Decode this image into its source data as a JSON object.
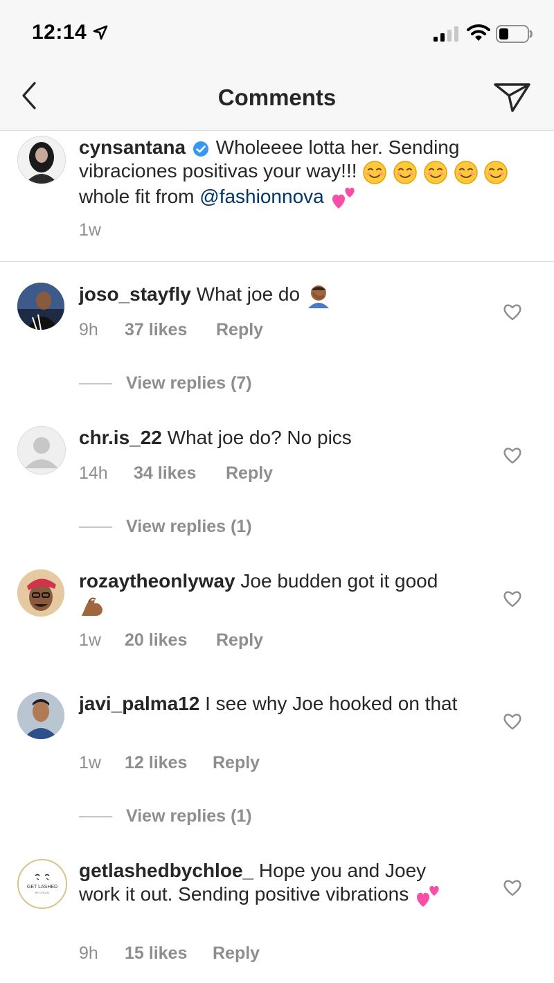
{
  "status": {
    "time": "12:14"
  },
  "nav": {
    "title": "Comments"
  },
  "caption": {
    "username": "cynsantana",
    "text_1": " Wholeeee lotta her. Sending vibraciones positivas your way!!! ",
    "text_2": " whole fit from ",
    "mention": "@fashionnova",
    "time": "1w"
  },
  "comments": [
    {
      "username": "joso_stayfly",
      "text": " What joe do ",
      "time": "9h",
      "likes": "37 likes",
      "reply": "Reply",
      "view_replies": "View replies (7)"
    },
    {
      "username": "chr.is_22",
      "text": " What joe do? No pics",
      "time": "14h",
      "likes": "34 likes",
      "reply": "Reply",
      "view_replies": "View replies (1)"
    },
    {
      "username": "rozaytheonlyway",
      "text": " Joe budden got it good ",
      "time": "1w",
      "likes": "20 likes",
      "reply": "Reply"
    },
    {
      "username": "javi_palma12",
      "text": " I see why Joe hooked on that",
      "time": "1w",
      "likes": "12 likes",
      "reply": "Reply",
      "view_replies": "View replies (1)"
    },
    {
      "username": "getlashedbychloe_",
      "text": " Hope you and Joey work it out. Sending positive vibrations",
      "time": "9h",
      "likes": "15 likes",
      "reply": "Reply",
      "avatar_text": "GET LASHED",
      "avatar_subtext": "BY CHLOE"
    }
  ],
  "icons": {
    "back": "chevron-left-icon",
    "send": "paper-plane-icon",
    "like": "heart-outline-icon",
    "verified": "verified-badge-icon",
    "smile": "smiling-face-emoji",
    "hearts": "two-hearts-emoji",
    "facepalm": "facepalm-emoji",
    "flex": "flexed-biceps-emoji"
  },
  "colors": {
    "verified": "#3897f0",
    "mention": "#003569",
    "muted": "#8e8e8e",
    "text": "#262626"
  }
}
